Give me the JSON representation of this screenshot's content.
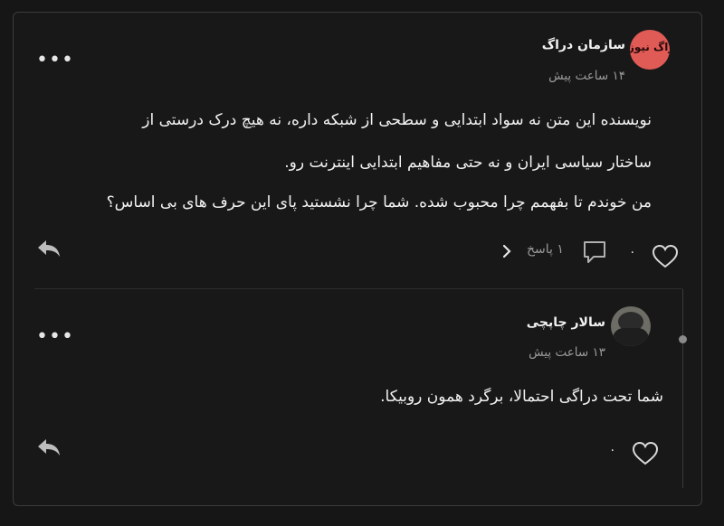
{
  "comment": {
    "author": "سازمان دراگ",
    "avatar_text": "دراگ نیوز",
    "time": "۱۴ ساعت پیش",
    "lines": [
      "نویسنده این متن نه سواد ابتدایی و سطحی از شبکه داره، نه هیچ درک درستی از",
      "ساختار سیاسی ایران و نه حتی مفاهیم ابتدایی اینترنت رو.",
      "من خوندم تا بفهمم چرا محبوب شده. شما چرا نشستید پای این حرف های بی اساس؟"
    ],
    "likes": "۰",
    "replies_label": "۱ پاسخ"
  },
  "reply": {
    "author": "سالار چاپچی",
    "time": "۱۳ ساعت پیش",
    "text": "شما تحت دراگی احتمالا، برگرد همون روبیکا.",
    "likes": "۰"
  },
  "icons": {
    "more": "more-horizontal-icon",
    "reply": "reply-arrow-icon",
    "heart": "heart-icon",
    "chat": "chat-bubble-icon",
    "chevron": "chevron-right-icon"
  },
  "colors": {
    "background": "#161616",
    "avatar_brand": "#e05a56",
    "text": "#f2f2f2",
    "muted": "#9a9a9a"
  }
}
